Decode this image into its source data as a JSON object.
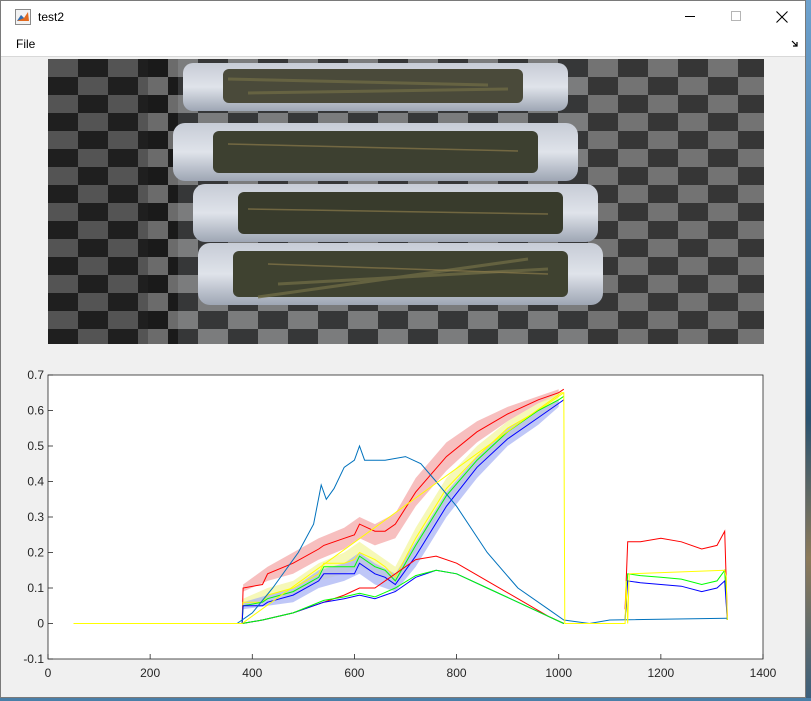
{
  "window": {
    "title": "test2",
    "menu": {
      "file_label": "File"
    }
  },
  "icons": {
    "app": "matlab-figure-icon",
    "minimize": "minimize-icon",
    "maximize": "maximize-icon",
    "close": "close-icon",
    "menu_overflow": "expand-arrow-icon"
  },
  "image": {
    "content": "hyperspectral image of four trays of tea leaves on a checkerboard background"
  },
  "chart_data": {
    "type": "line",
    "xlim": [
      0,
      1400
    ],
    "ylim": [
      -0.1,
      0.7
    ],
    "x_ticks": [
      0,
      200,
      400,
      600,
      800,
      1000,
      1200,
      1400
    ],
    "y_ticks": [
      -0.1,
      0,
      0.1,
      0.2,
      0.3,
      0.4,
      0.5,
      0.6,
      0.7
    ],
    "x_tick_labels": [
      "0",
      "200",
      "400",
      "600",
      "800",
      "1000",
      "1200",
      "1400"
    ],
    "y_tick_labels": [
      "-0.1",
      "0",
      "0.1",
      "0.2",
      "0.3",
      "0.4",
      "0.5",
      "0.6",
      "0.7"
    ],
    "grid": false,
    "colors": {
      "red": "#ff0000",
      "yellow": "#ffff00",
      "green": "#00ff00",
      "blue": "#0000ff",
      "teal": "#0072bd",
      "red_band": "#f4a9a9",
      "yellow_band": "#f3f5a0",
      "green_band": "#b9f5a0",
      "blue_band": "#a9b4f4"
    },
    "series": [
      {
        "color_key": "red",
        "x": [
          50,
          380,
          382,
          420,
          430,
          480,
          530,
          540,
          580,
          600,
          610,
          640,
          660,
          680,
          720,
          780,
          840,
          900,
          960,
          1000,
          1010
        ],
        "y": [
          0,
          0,
          0.1,
          0.11,
          0.14,
          0.17,
          0.21,
          0.22,
          0.24,
          0.25,
          0.28,
          0.26,
          0.26,
          0.28,
          0.37,
          0.47,
          0.54,
          0.59,
          0.63,
          0.65,
          0.66
        ]
      },
      {
        "color_key": "yellow",
        "x": [
          50,
          380,
          382,
          420,
          430,
          480,
          530,
          540,
          580,
          600,
          610,
          640,
          660,
          680,
          720,
          780,
          840,
          900,
          960,
          1000,
          1010
        ],
        "y": [
          0,
          0,
          0.06,
          0.06,
          0.08,
          0.1,
          0.14,
          0.17,
          0.17,
          0.18,
          0.2,
          0.18,
          0.16,
          0.13,
          0.24,
          0.38,
          0.47,
          0.55,
          0.6,
          0.64,
          0.65
        ]
      },
      {
        "color_key": "green",
        "x": [
          50,
          380,
          382,
          420,
          430,
          480,
          530,
          540,
          580,
          600,
          610,
          640,
          660,
          680,
          720,
          780,
          840,
          900,
          960,
          1000,
          1010
        ],
        "y": [
          0,
          0,
          0.05,
          0.06,
          0.07,
          0.09,
          0.13,
          0.16,
          0.16,
          0.16,
          0.19,
          0.16,
          0.15,
          0.12,
          0.22,
          0.36,
          0.46,
          0.54,
          0.6,
          0.63,
          0.64
        ]
      },
      {
        "color_key": "blue",
        "x": [
          50,
          380,
          382,
          420,
          430,
          480,
          530,
          540,
          580,
          600,
          610,
          640,
          660,
          680,
          720,
          780,
          840,
          900,
          960,
          1000,
          1010
        ],
        "y": [
          0,
          0,
          0.05,
          0.05,
          0.06,
          0.08,
          0.12,
          0.14,
          0.14,
          0.14,
          0.17,
          0.14,
          0.13,
          0.11,
          0.19,
          0.33,
          0.44,
          0.52,
          0.58,
          0.62,
          0.63
        ]
      },
      {
        "color_key": "teal",
        "x": [
          50,
          370,
          400,
          440,
          490,
          520,
          535,
          545,
          560,
          580,
          600,
          610,
          620,
          660,
          700,
          730,
          760,
          800,
          860,
          920,
          980,
          1010,
          1060,
          1100,
          1330
        ],
        "y": [
          0,
          0,
          0.03,
          0.1,
          0.2,
          0.28,
          0.39,
          0.35,
          0.38,
          0.44,
          0.46,
          0.5,
          0.46,
          0.46,
          0.47,
          0.45,
          0.4,
          0.33,
          0.2,
          0.1,
          0.04,
          0.01,
          0,
          0.01,
          0.015
        ]
      },
      {
        "color_key": "red",
        "x": [
          380,
          420,
          480,
          540,
          580,
          610,
          640,
          680,
          720,
          760,
          800,
          860,
          920,
          980,
          1010
        ],
        "y": [
          0,
          0.01,
          0.03,
          0.06,
          0.08,
          0.1,
          0.1,
          0.14,
          0.18,
          0.19,
          0.17,
          0.12,
          0.07,
          0.02,
          0
        ]
      },
      {
        "color_key": "blue",
        "x": [
          380,
          420,
          480,
          540,
          580,
          610,
          640,
          680,
          720,
          760,
          800,
          860,
          920,
          980,
          1010
        ],
        "y": [
          0,
          0.01,
          0.03,
          0.06,
          0.07,
          0.08,
          0.07,
          0.09,
          0.13,
          0.15,
          0.14,
          0.1,
          0.06,
          0.02,
          0
        ]
      },
      {
        "color_key": "green",
        "x": [
          380,
          420,
          480,
          540,
          580,
          610,
          640,
          680,
          720,
          760,
          800,
          860,
          920,
          980,
          1010
        ],
        "y": [
          0,
          0.01,
          0.03,
          0.065,
          0.075,
          0.085,
          0.075,
          0.1,
          0.135,
          0.15,
          0.14,
          0.1,
          0.06,
          0.02,
          0
        ]
      },
      {
        "color_key": "red",
        "x": [
          1130,
          1135,
          1160,
          1200,
          1240,
          1280,
          1310,
          1325,
          1330
        ],
        "y": [
          0.04,
          0.23,
          0.23,
          0.24,
          0.23,
          0.21,
          0.22,
          0.26,
          0.02
        ]
      },
      {
        "color_key": "green",
        "x": [
          1130,
          1135,
          1160,
          1200,
          1240,
          1280,
          1310,
          1325,
          1330
        ],
        "y": [
          0.01,
          0.14,
          0.135,
          0.13,
          0.125,
          0.11,
          0.12,
          0.15,
          0.01
        ]
      },
      {
        "color_key": "blue",
        "x": [
          1130,
          1135,
          1160,
          1200,
          1240,
          1280,
          1310,
          1325,
          1330
        ],
        "y": [
          0.01,
          0.12,
          0.115,
          0.11,
          0.105,
          0.09,
          0.1,
          0.12,
          0.01
        ]
      },
      {
        "color_key": "yellow",
        "x": [
          50,
          380,
          1005,
          1010,
          1012,
          1130,
          1132,
          1135,
          1138,
          1325,
          1328,
          1330
        ],
        "y": [
          0,
          0,
          0.65,
          0.65,
          0,
          0,
          0.12,
          0,
          0.14,
          0.15,
          0.13,
          0.01
        ]
      }
    ],
    "bands": [
      {
        "color_key": "red_band",
        "x": [
          382,
          430,
          480,
          530,
          580,
          610,
          640,
          680,
          720,
          780,
          840,
          900,
          960,
          1000
        ],
        "upper": [
          0.11,
          0.16,
          0.2,
          0.24,
          0.27,
          0.3,
          0.28,
          0.31,
          0.41,
          0.51,
          0.57,
          0.61,
          0.64,
          0.66
        ],
        "lower": [
          0.09,
          0.12,
          0.14,
          0.18,
          0.21,
          0.24,
          0.22,
          0.24,
          0.33,
          0.43,
          0.51,
          0.57,
          0.62,
          0.64
        ]
      },
      {
        "color_key": "yellow_band",
        "x": [
          382,
          430,
          480,
          530,
          580,
          610,
          640,
          680,
          720,
          780,
          840,
          900,
          960,
          1000
        ],
        "upper": [
          0.07,
          0.1,
          0.12,
          0.17,
          0.2,
          0.23,
          0.2,
          0.16,
          0.27,
          0.41,
          0.5,
          0.57,
          0.62,
          0.65
        ],
        "lower": [
          0.05,
          0.07,
          0.08,
          0.12,
          0.14,
          0.16,
          0.14,
          0.11,
          0.2,
          0.34,
          0.44,
          0.52,
          0.58,
          0.62
        ]
      },
      {
        "color_key": "blue_band",
        "x": [
          382,
          430,
          480,
          530,
          580,
          610,
          640,
          680,
          720,
          780,
          840,
          900,
          960,
          1000
        ],
        "upper": [
          0.06,
          0.08,
          0.1,
          0.15,
          0.17,
          0.2,
          0.17,
          0.14,
          0.23,
          0.37,
          0.47,
          0.55,
          0.6,
          0.63
        ],
        "lower": [
          0.04,
          0.05,
          0.06,
          0.1,
          0.12,
          0.14,
          0.11,
          0.09,
          0.16,
          0.3,
          0.41,
          0.5,
          0.56,
          0.61
        ]
      }
    ]
  }
}
